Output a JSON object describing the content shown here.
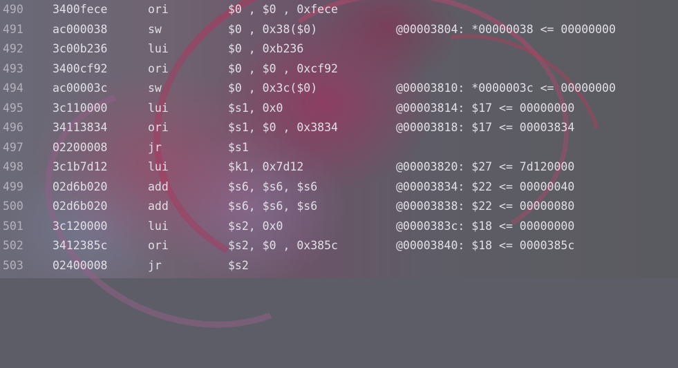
{
  "rows": [
    {
      "ln": "490",
      "addr": "3400fece",
      "op": "ori",
      "args": "$0 , $0 , 0xfece",
      "trace": ""
    },
    {
      "ln": "491",
      "addr": "ac000038",
      "op": "sw",
      "args": "$0 , 0x38($0)",
      "trace": "@00003804: *00000038 <= 00000000"
    },
    {
      "ln": "492",
      "addr": "3c00b236",
      "op": "lui",
      "args": "$0 , 0xb236",
      "trace": ""
    },
    {
      "ln": "493",
      "addr": "3400cf92",
      "op": "ori",
      "args": "$0 , $0 , 0xcf92",
      "trace": ""
    },
    {
      "ln": "494",
      "addr": "ac00003c",
      "op": "sw",
      "args": "$0 , 0x3c($0)",
      "trace": "@00003810: *0000003c <= 00000000"
    },
    {
      "ln": "495",
      "addr": "3c110000",
      "op": "lui",
      "args": "$s1, 0x0",
      "trace": "@00003814: $17 <= 00000000"
    },
    {
      "ln": "496",
      "addr": "34113834",
      "op": "ori",
      "args": "$s1, $0 , 0x3834",
      "trace": "@00003818: $17 <= 00003834"
    },
    {
      "ln": "497",
      "addr": "02200008",
      "op": "jr",
      "args": "$s1",
      "trace": ""
    },
    {
      "ln": "498",
      "addr": "3c1b7d12",
      "op": "lui",
      "args": "$k1, 0x7d12",
      "trace": "@00003820: $27 <= 7d120000"
    },
    {
      "ln": "499",
      "addr": "02d6b020",
      "op": "add",
      "args": "$s6, $s6, $s6",
      "trace": "@00003834: $22 <= 00000040"
    },
    {
      "ln": "500",
      "addr": "02d6b020",
      "op": "add",
      "args": "$s6, $s6, $s6",
      "trace": "@00003838: $22 <= 00000080"
    },
    {
      "ln": "501",
      "addr": "3c120000",
      "op": "lui",
      "args": "$s2, 0x0",
      "trace": "@0000383c: $18 <= 00000000"
    },
    {
      "ln": "502",
      "addr": "3412385c",
      "op": "ori",
      "args": "$s2, $0 , 0x385c",
      "trace": "@00003840: $18 <= 0000385c"
    },
    {
      "ln": "503",
      "addr": "02400008",
      "op": "jr",
      "args": "$s2",
      "trace": ""
    }
  ]
}
